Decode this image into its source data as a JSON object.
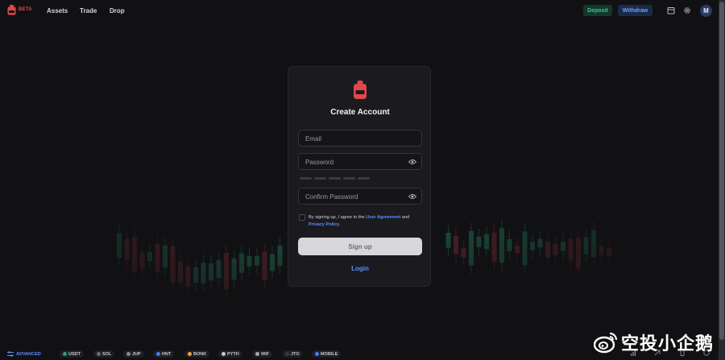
{
  "header": {
    "beta_label": "BETA",
    "nav": [
      "Assets",
      "Trade",
      "Drop"
    ],
    "deposit_label": "Deposit",
    "withdraw_label": "Withdraw",
    "avatar_initial": "M",
    "icons": [
      "calendar-icon",
      "gear-icon"
    ]
  },
  "signup": {
    "title": "Create Account",
    "email_placeholder": "Email",
    "password_placeholder": "Password",
    "confirm_placeholder": "Confirm Password",
    "terms_prefix": "By signing up, I agree to the ",
    "terms_link_1": "User Agreement",
    "terms_mid": " and ",
    "terms_link_2": "Privacy Policy",
    "terms_suffix": ".",
    "signup_label": "Sign up",
    "login_label": "Login"
  },
  "ticker": {
    "advanced_label": "ADVANCED",
    "items": [
      {
        "label": "USDT",
        "color": "#26a17b"
      },
      {
        "label": "SOL",
        "color": "#6b6b73"
      },
      {
        "label": "JUP",
        "color": "#8a8a95"
      },
      {
        "label": "HNT",
        "color": "#4a78ff"
      },
      {
        "label": "BONK",
        "color": "#f0a33a"
      },
      {
        "label": "PYTH",
        "color": "#c9c9d1"
      },
      {
        "label": "WIF",
        "color": "#a8a8b0"
      },
      {
        "label": "JTO",
        "color": "#3a3a42"
      },
      {
        "label": "MOBILE",
        "color": "#4a78ff"
      }
    ]
  },
  "watermark": {
    "text": "空投小企鹅"
  },
  "colors": {
    "accent_blue": "#5b8eff",
    "brand_red": "#e0474c",
    "deposit_green": "#36c98a"
  }
}
